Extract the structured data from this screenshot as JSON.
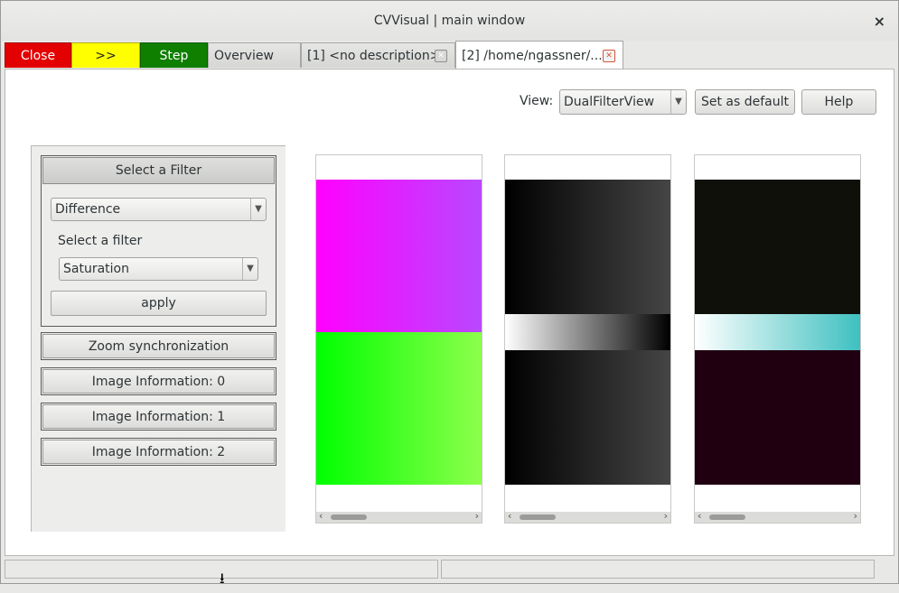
{
  "window": {
    "title": "CVVisual | main window",
    "close_symbol": "×"
  },
  "tabs": {
    "close": {
      "label": "Close",
      "color": "#e30000"
    },
    "forward": {
      "label": ">>",
      "color": "#ffff00"
    },
    "step": {
      "label": "Step",
      "color": "#0f7f00"
    },
    "overview": {
      "label": "Overview"
    },
    "tab1": {
      "label": "[1] <no description>"
    },
    "tab2": {
      "label": "[2] /home/ngassner/..."
    }
  },
  "toolbar": {
    "view_label": "View:",
    "view_value": "DualFilterView",
    "set_default": "Set as default",
    "help": "Help"
  },
  "filter_panel": {
    "header": "Select a Filter",
    "filter_combo": "Difference",
    "sub_label": "Select a filter",
    "sub_combo": "Saturation",
    "apply": "apply"
  },
  "panel_buttons": {
    "zoom_sync": "Zoom synchronization",
    "info0": "Image Information: 0",
    "info1": "Image Information: 1",
    "info2": "Image Information: 2"
  },
  "images": {
    "left": {
      "top_gradient": [
        "#ff00ff",
        "#b948ff"
      ],
      "bottom_gradient": [
        "#00ff00",
        "#8dff4c"
      ]
    },
    "middle": {
      "top_gradient": [
        "#000000",
        "#454545"
      ],
      "mid_gradient": [
        "#ffffff",
        "#000000"
      ],
      "bottom_gradient": [
        "#000000",
        "#454545"
      ]
    },
    "right": {
      "top_color": "#10100a",
      "mid_gradient": [
        "#ffffff",
        "#3ec0c0"
      ],
      "bottom_color": "#200010"
    }
  },
  "icons": {
    "dropdown": "chevron-down-icon",
    "tab_close": "close-icon",
    "cursor": "cursor-icon"
  }
}
